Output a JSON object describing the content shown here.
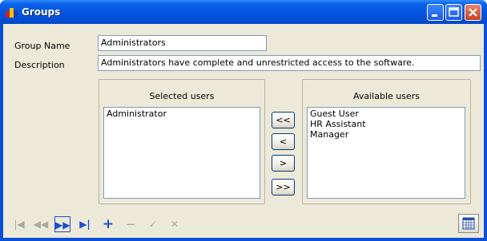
{
  "window": {
    "title": "Groups"
  },
  "form": {
    "group_name_label": "Group Name",
    "group_name_value": "Administrators",
    "description_label": "Description",
    "description_value": "Administrators have complete and unrestricted access to the software."
  },
  "selected_users": {
    "title": "Selected users",
    "items": [
      "Administrator"
    ]
  },
  "available_users": {
    "title": "Available users",
    "items": [
      "Guest User",
      "HR Assistant",
      "Manager"
    ]
  },
  "move_buttons": {
    "add_all": "<<",
    "add": "<",
    "remove": ">",
    "remove_all": ">>"
  },
  "nav": {
    "first": "|◀",
    "prev": "◀◀",
    "next": "▶▶",
    "last": "▶|",
    "add": "+",
    "delete": "−",
    "confirm": "✓",
    "cancel": "✕"
  },
  "colors": {
    "titlebar": "#0552df",
    "client_bg": "#ece9d8",
    "nav_blue": "#1c4fd0"
  }
}
